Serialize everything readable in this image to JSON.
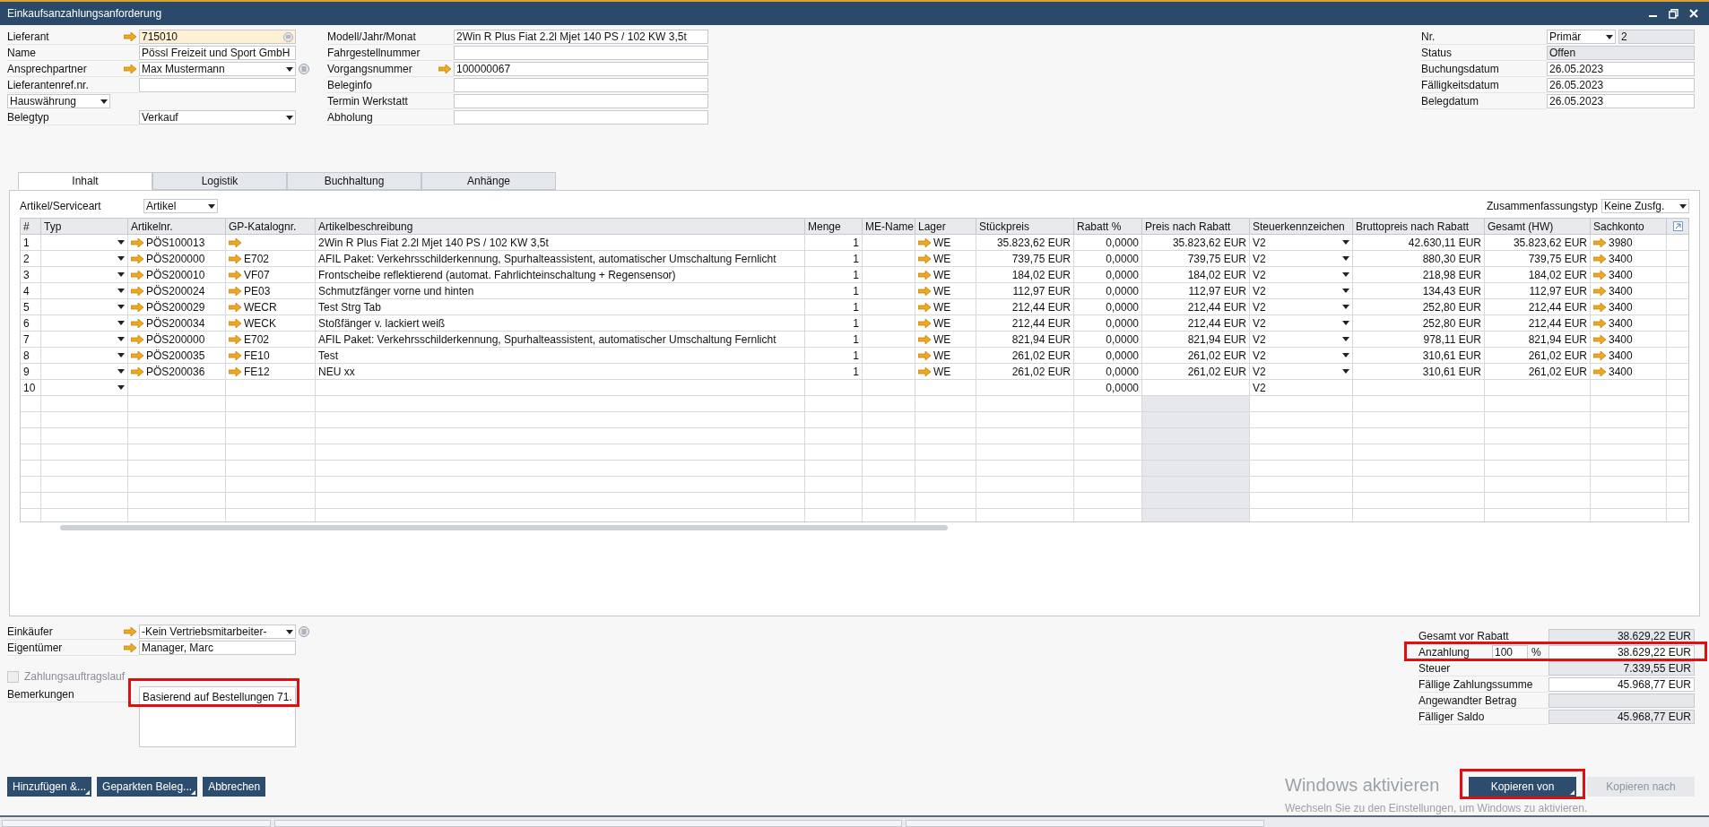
{
  "window": {
    "title": "Einkaufsanzahlungsanforderung"
  },
  "header_left": [
    {
      "kind": "lookup",
      "label": "Lieferant",
      "value": "715010"
    },
    {
      "kind": "field",
      "label": "Name",
      "value": "Pössl Freizeit und Sport GmbH"
    },
    {
      "kind": "contact",
      "label": "Ansprechpartner",
      "value": "Max Mustermann"
    },
    {
      "kind": "field",
      "label": "Lieferantenref.nr."
    },
    {
      "kind": "currency",
      "label": "Hauswährung"
    },
    {
      "kind": "dropdown",
      "label": "Belegtyp",
      "value": "Verkauf"
    }
  ],
  "header_middle": [
    {
      "kind": "field",
      "label": "Modell/Jahr/Monat",
      "value": "2Win R Plus Fiat 2.2l Mjet 140 PS / 102 KW 3,5t"
    },
    {
      "kind": "field",
      "label": "Fahrgestellnummer"
    },
    {
      "kind": "link",
      "label": "Vorgangsnummer",
      "value": "100000067"
    },
    {
      "kind": "field",
      "label": "Beleginfo"
    },
    {
      "kind": "field",
      "label": "Termin Werkstatt"
    },
    {
      "kind": "field",
      "label": "Abholung"
    }
  ],
  "header_right": [
    {
      "kind": "series",
      "label": "Nr.",
      "series": "Primär",
      "value": "2"
    },
    {
      "kind": "readonly",
      "label": "Status",
      "value": "Offen"
    },
    {
      "kind": "field",
      "label": "Buchungsdatum",
      "value": "26.05.2023"
    },
    {
      "kind": "field",
      "label": "Fälligkeitsdatum",
      "value": "26.05.2023"
    },
    {
      "kind": "field",
      "label": "Belegdatum",
      "value": "26.05.2023"
    }
  ],
  "tabs": [
    {
      "label": "Inhalt",
      "selected": true
    },
    {
      "label": "Logistik",
      "selected": false
    },
    {
      "label": "Buchhaltung",
      "selected": false
    },
    {
      "label": "Anhänge",
      "selected": false
    }
  ],
  "item_type": {
    "label": "Artikel/Serviceart",
    "value": "Artikel"
  },
  "summary_type": {
    "label": "Zusammenfassungstyp",
    "value": "Keine Zusfg."
  },
  "table": {
    "columns": [
      {
        "label": "#",
        "kind": "index",
        "shaded": false
      },
      {
        "label": "Typ",
        "kind": "dropdown",
        "shaded": false
      },
      {
        "label": "Artikelnr.",
        "kind": "link",
        "shaded": false
      },
      {
        "label": "GP-Katalognr.",
        "kind": "link",
        "shaded": false
      },
      {
        "label": "Artikelbeschreibung",
        "kind": "text",
        "shaded": false
      },
      {
        "label": "Menge",
        "kind": "amount",
        "shaded": false
      },
      {
        "label": "ME-Name",
        "kind": "text",
        "shaded": false
      },
      {
        "label": "Lager",
        "kind": "link",
        "shaded": false
      },
      {
        "label": "Stückpreis",
        "kind": "amount",
        "shaded": false
      },
      {
        "label": "Rabatt %",
        "kind": "amount",
        "shaded": false
      },
      {
        "label": "Preis nach Rabatt",
        "kind": "amount",
        "shaded": true
      },
      {
        "label": "Steuerkennzeichen",
        "kind": "taxcode",
        "shaded": false
      },
      {
        "label": "Bruttopreis nach Rabatt",
        "kind": "amount",
        "shaded": false
      },
      {
        "label": "Gesamt (HW)",
        "kind": "amount",
        "shaded": false
      },
      {
        "label": "Sachkonto",
        "kind": "link",
        "shaded": false
      }
    ],
    "rows": [
      {
        "linked": true,
        "cells": [
          "1",
          null,
          "PÖS100013",
          null,
          "2Win R Plus Fiat 2.2l Mjet 140 PS / 102 KW 3,5t",
          "1",
          null,
          "WE",
          "35.823,62 EUR",
          "0,0000",
          "35.823,62 EUR",
          "V2",
          "42.630,11 EUR",
          "35.823,62 EUR",
          "3980"
        ]
      },
      {
        "linked": true,
        "cells": [
          "2",
          null,
          "PÖS200000",
          "E702",
          "AFIL Paket: Verkehrsschilderkennung, Spurhalteassistent, automatischer Umschaltung Fernlicht",
          "1",
          null,
          "WE",
          "739,75 EUR",
          "0,0000",
          "739,75 EUR",
          "V2",
          "880,30 EUR",
          "739,75 EUR",
          "3400"
        ]
      },
      {
        "linked": true,
        "cells": [
          "3",
          null,
          "PÖS200010",
          "VF07",
          "Frontscheibe reflektierend (automat. Fahrlichteinschaltung + Regensensor)",
          "1",
          null,
          "WE",
          "184,02 EUR",
          "0,0000",
          "184,02 EUR",
          "V2",
          "218,98 EUR",
          "184,02 EUR",
          "3400"
        ]
      },
      {
        "linked": true,
        "cells": [
          "4",
          null,
          "PÖS200024",
          "PE03",
          "Schmutzfänger vorne und hinten",
          "1",
          null,
          "WE",
          "112,97 EUR",
          "0,0000",
          "112,97 EUR",
          "V2",
          "134,43 EUR",
          "112,97 EUR",
          "3400"
        ]
      },
      {
        "linked": true,
        "cells": [
          "5",
          null,
          "PÖS200029",
          "WECR",
          "Test Strg Tab",
          "1",
          null,
          "WE",
          "212,44 EUR",
          "0,0000",
          "212,44 EUR",
          "V2",
          "252,80 EUR",
          "212,44 EUR",
          "3400"
        ]
      },
      {
        "linked": true,
        "cells": [
          "6",
          null,
          "PÖS200034",
          "WECK",
          "Stoßfänger v. lackiert weiß",
          "1",
          null,
          "WE",
          "212,44 EUR",
          "0,0000",
          "212,44 EUR",
          "V2",
          "252,80 EUR",
          "212,44 EUR",
          "3400"
        ]
      },
      {
        "linked": true,
        "cells": [
          "7",
          null,
          "PÖS200000",
          "E702",
          "AFIL Paket: Verkehrsschilderkennung, Spurhalteassistent, automatischer Umschaltung Fernlicht",
          "1",
          null,
          "WE",
          "821,94 EUR",
          "0,0000",
          "821,94 EUR",
          "V2",
          "978,11 EUR",
          "821,94 EUR",
          "3400"
        ]
      },
      {
        "linked": true,
        "cells": [
          "8",
          null,
          "PÖS200035",
          "FE10",
          "Test",
          "1",
          null,
          "WE",
          "261,02 EUR",
          "0,0000",
          "261,02 EUR",
          "V2",
          "310,61 EUR",
          "261,02 EUR",
          "3400"
        ]
      },
      {
        "linked": true,
        "cells": [
          "9",
          null,
          "PÖS200036",
          "FE12",
          "NEU xx",
          "1",
          null,
          "WE",
          "261,02 EUR",
          "0,0000",
          "261,02 EUR",
          "V2",
          "310,61 EUR",
          "261,02 EUR",
          "3400"
        ]
      },
      {
        "linked": false,
        "cells": [
          "10",
          null,
          null,
          null,
          null,
          null,
          null,
          null,
          null,
          "0,0000",
          null,
          "V2",
          null,
          null,
          null
        ]
      }
    ]
  },
  "footer_left": [
    {
      "kind": "dropdown",
      "label": "Einkäufer",
      "value": "-Kein Vertriebsmitarbeiter-"
    },
    {
      "kind": "link",
      "label": "Eigentümer",
      "value": "Manager, Marc"
    }
  ],
  "payment_run": {
    "label": "Zahlungsauftragslauf",
    "checked": false,
    "disabled": true
  },
  "remarks": {
    "label": "Bemerkungen",
    "value": "Basierend auf Bestellungen 71.",
    "highlighted": true
  },
  "totals": [
    {
      "kind": "readonly",
      "label": "Gesamt vor Rabatt",
      "value": "38.629,22 EUR",
      "highlighted": false
    },
    {
      "kind": "percent",
      "label": "Anzahlung",
      "percent": "100",
      "unit": "%",
      "value": "38.629,22 EUR",
      "highlighted": true
    },
    {
      "kind": "readonly",
      "label": "Steuer",
      "value": "7.339,55 EUR",
      "highlighted": false
    },
    {
      "kind": "field",
      "label": "Fällige Zahlungssumme",
      "value": "45.968,77 EUR",
      "highlighted": false
    },
    {
      "kind": "readonly",
      "label": "Angewandter Betrag",
      "highlighted": false
    },
    {
      "kind": "readonly",
      "label": "Fälliger Saldo",
      "value": "45.968,77 EUR",
      "highlighted": false
    }
  ],
  "buttons_left": [
    {
      "label": "Hinzufügen &...",
      "menu": true
    },
    {
      "label": "Geparkten Beleg...",
      "menu": true
    },
    {
      "label": "Abbrechen",
      "menu": false
    }
  ],
  "buttons_right": [
    {
      "label": "Kopieren von",
      "menu": true,
      "disabled": false,
      "highlighted": true
    },
    {
      "label": "Kopieren nach",
      "menu": false,
      "disabled": true,
      "highlighted": false
    }
  ],
  "windows_notice": {
    "title": "Windows aktivieren",
    "text": "Wechseln Sie zu den Einstellungen, um Windows zu aktivieren."
  }
}
